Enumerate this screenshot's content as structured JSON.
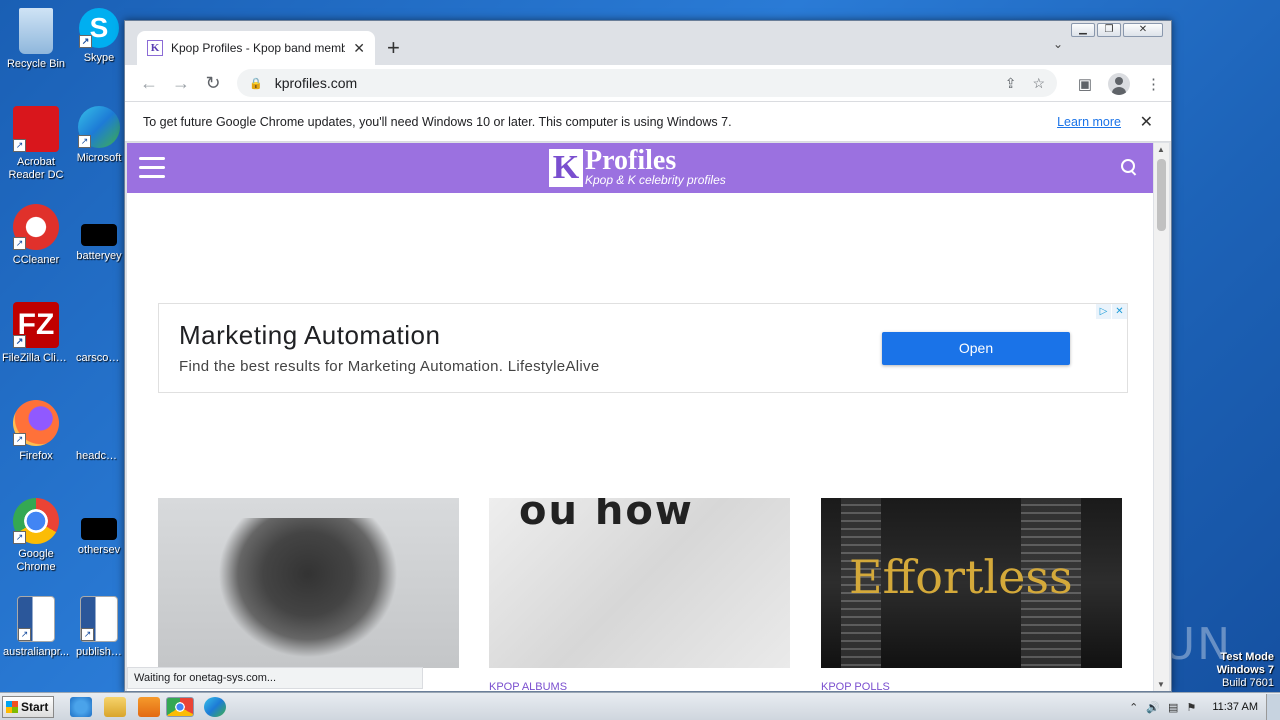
{
  "desktop": {
    "icons": [
      {
        "label": "Recycle Bin",
        "icon": "recycle-bin-icon"
      },
      {
        "label": "Skype",
        "icon": "skype-icon"
      },
      {
        "label": "Acrobat Reader DC",
        "icon": "acrobat-icon"
      },
      {
        "label": "Microsoft",
        "icon": "edge-icon"
      },
      {
        "label": "CCleaner",
        "icon": "ccleaner-icon"
      },
      {
        "label": "batteryey",
        "icon": "file-icon"
      },
      {
        "label": "FileZilla Client",
        "icon": "filezilla-icon"
      },
      {
        "label": "carscore...",
        "icon": "file-icon"
      },
      {
        "label": "Firefox",
        "icon": "firefox-icon"
      },
      {
        "label": "headcar...",
        "icon": "file-icon"
      },
      {
        "label": "Google Chrome",
        "icon": "chrome-icon"
      },
      {
        "label": "othersev",
        "icon": "file-icon"
      },
      {
        "label": "australianpr...",
        "icon": "word-icon"
      },
      {
        "label": "publishing",
        "icon": "word-icon"
      }
    ]
  },
  "browser": {
    "tab_title": "Kpop Profiles - Kpop band member p",
    "favicon_letter": "K",
    "url": "kprofiles.com",
    "infobar_text": "To get future Google Chrome updates, you'll need Windows 10 or later. This computer is using Windows 7.",
    "infobar_link": "Learn more",
    "status_text": "Waiting for onetag-sys.com..."
  },
  "site": {
    "logo_letter": "K",
    "logo_name": "Profiles",
    "logo_tagline": "Kpop & K celebrity profiles",
    "ad": {
      "title": "Marketing Automation",
      "description": "Find the best results for Marketing Automation. LifestyleAlive",
      "button": "Open"
    },
    "cards": [
      {
        "category": "",
        "image_text": ""
      },
      {
        "category": "KPOP ALBUMS",
        "image_text": "ou how"
      },
      {
        "category": "KPOP POLLS",
        "image_text": "Effortless"
      }
    ]
  },
  "taskbar": {
    "start_label": "Start",
    "clock": "11:37 AM"
  },
  "overlay": {
    "test_mode": "Test Mode",
    "windows_version": "Windows 7",
    "build": "Build 7601",
    "watermark": "ANY RUN"
  },
  "colors": {
    "site_header": "#9b71e0",
    "ad_button": "#1a73e8",
    "category_text": "#7a4fcf"
  }
}
